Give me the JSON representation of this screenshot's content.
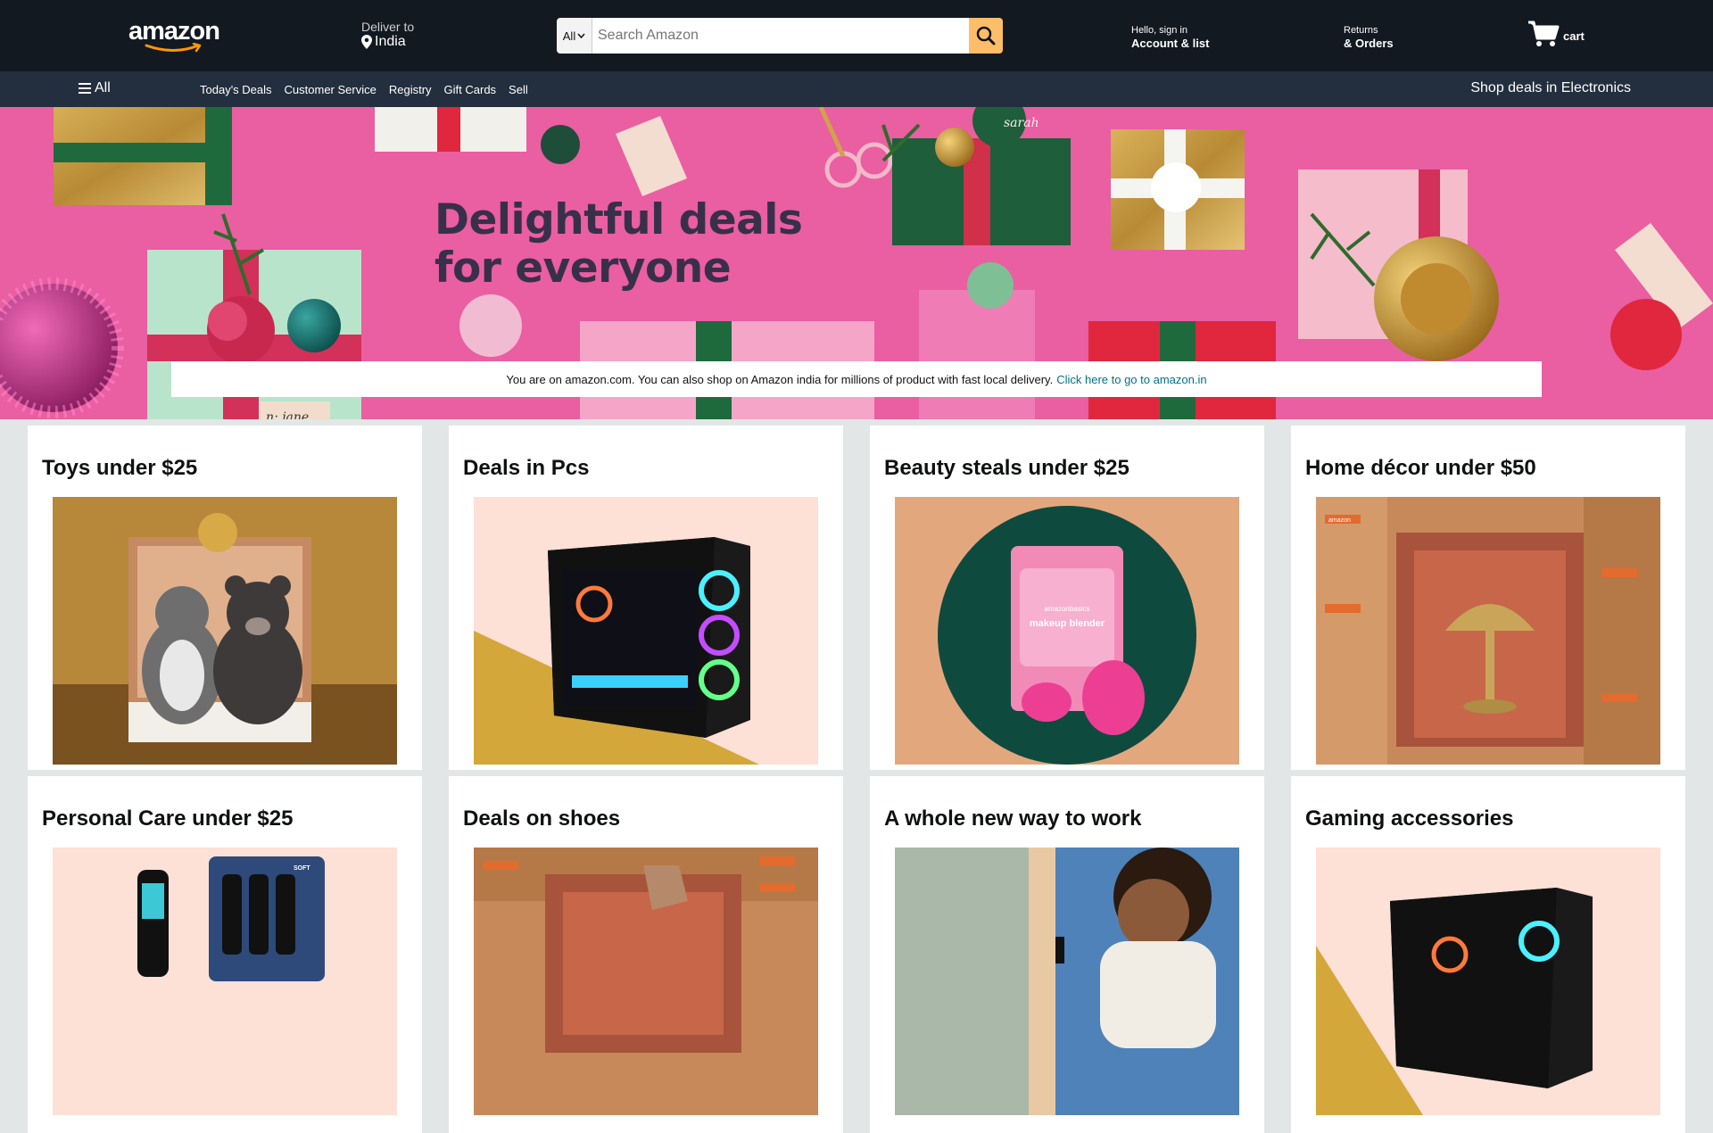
{
  "header": {
    "logo_text": "amazon",
    "deliver_label": "Deliver to",
    "deliver_location": "India",
    "search": {
      "category": "All",
      "placeholder": "Search Amazon"
    },
    "account_small": "Hello, sign in",
    "account_big": "Account & list",
    "returns_small": "Returns",
    "returns_big": "& Orders",
    "cart_label": "cart"
  },
  "subnav": {
    "all_label": "All",
    "links": [
      "Today's Deals",
      "Customer Service",
      "Registry",
      "Gift Cards",
      "Sell"
    ],
    "promo": "Shop deals in Electronics"
  },
  "hero": {
    "title_line1": "Delightful deals",
    "title_line2": "for everyone",
    "notice_text": "You are on amazon.com. You can also shop on Amazon india for millions of product with fast local delivery.",
    "notice_link": "Click here to go to amazon.in",
    "tag_text_1": "sarah",
    "tag_text_2": "n: jane"
  },
  "cards": [
    {
      "title": "Toys under $25",
      "image": "plush-toys-gift-box"
    },
    {
      "title": "Deals in Pcs",
      "image": "gaming-pc-tower"
    },
    {
      "title": "Beauty steals under $25",
      "image": "makeup-blender"
    },
    {
      "title": "Home décor under $50",
      "image": "lamp-in-boxes"
    },
    {
      "title": "Personal Care under $25",
      "image": "toothbrushes"
    },
    {
      "title": "Deals on shoes",
      "image": "shoes-in-boxes"
    },
    {
      "title": "A whole new way to work",
      "image": "person-working"
    },
    {
      "title": "Gaming accessories",
      "image": "gaming-pc-tower"
    }
  ],
  "product_text": {
    "blender_brand": "amazonbasics",
    "blender_name": "makeup blender",
    "box_brand": "amazon",
    "brush_label": "SOFT"
  },
  "colors": {
    "nav_bg": "#131921",
    "subnav_bg": "#232f3e",
    "search_button": "#febd69",
    "hero_pink": "#e9559d",
    "link": "#007185"
  }
}
